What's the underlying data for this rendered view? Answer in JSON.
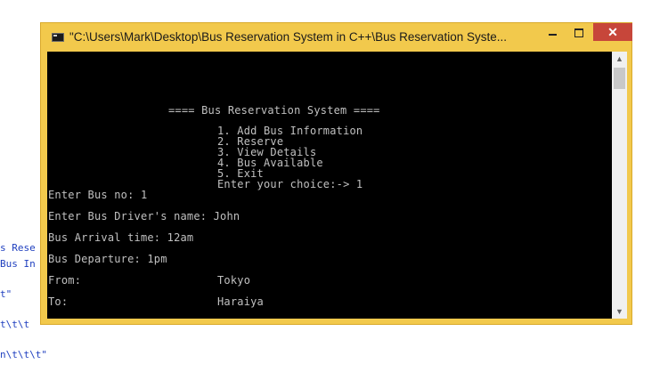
{
  "background_code": {
    "lines": [
      "s Rese",
      "Bus In",
      "t\"",
      "t\\t\\t",
      "n\\t\\t\\t\""
    ]
  },
  "window": {
    "title": "\"C:\\Users\\Mark\\Desktop\\Bus Reservation System in C++\\Bus Reservation Syste...",
    "icon": "console-icon",
    "controls": {
      "minimize": "minimize-icon",
      "maximize": "maximize-icon",
      "close": "✕"
    }
  },
  "console": {
    "header": "==== Bus Reservation System ====",
    "menu": [
      "1. Add Bus Information",
      "2. Reserve",
      "3. View Details",
      "4. Bus Available",
      "5. Exit"
    ],
    "prompt": "Enter your choice:-> 1",
    "fields": [
      {
        "label": "Enter Bus no: 1",
        "value": ""
      },
      {
        "label": "Enter Bus Driver's name: John",
        "value": ""
      },
      {
        "label": "Bus Arrival time: 12am",
        "value": ""
      },
      {
        "label": "Bus Departure: 1pm",
        "value": ""
      },
      {
        "label": "From:",
        "value": "Tokyo"
      },
      {
        "label": "To:",
        "value": "Haraiya"
      }
    ]
  },
  "colors": {
    "console_bg": "#000000",
    "console_text": "#c0c0c0",
    "window_frame": "#f2c94c",
    "close_button": "#c7463a"
  }
}
